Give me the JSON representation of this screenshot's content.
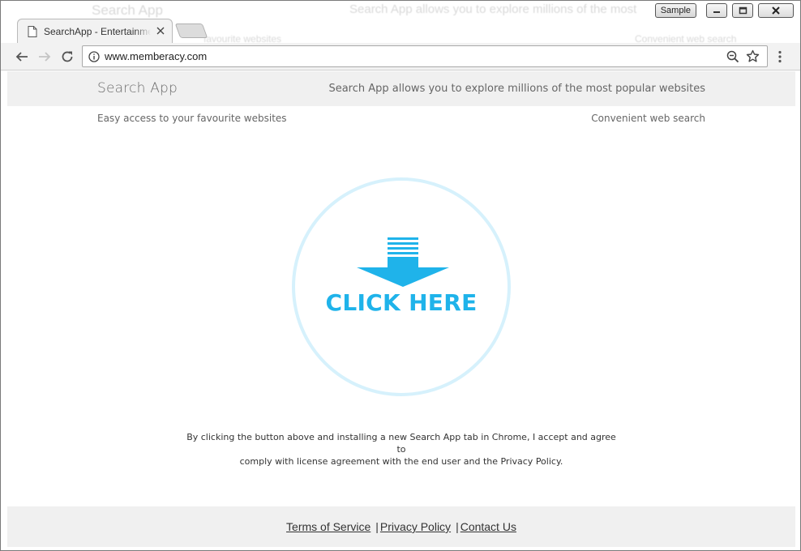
{
  "window": {
    "sample_label": "Sample",
    "ghost_brand": "Search App",
    "ghost_tagline": "Search App allows you to explore millions of the most",
    "ghost_feature_left": "favourite websites",
    "ghost_feature_right": "Convenient web search"
  },
  "tab": {
    "title": "SearchApp - Entertainment",
    "icon": "page-icon"
  },
  "toolbar": {
    "url": "www.memberacy.com"
  },
  "header": {
    "brand": "Search App",
    "tagline": "Search App allows you to explore millions of the most popular websites"
  },
  "features": {
    "left": "Easy access to your favourite websites",
    "right": "Convenient web search"
  },
  "cta": {
    "label": "CLICK HERE",
    "color": "#1fb3ea",
    "ring_color": "#d6f1fc"
  },
  "legal": {
    "line1": "By clicking the button above and installing a new Search App tab in Chrome, I accept and agree to",
    "line2": "comply with license agreement with the end user and the Privacy Policy."
  },
  "footer": {
    "links": [
      "Terms of Service",
      "Privacy Policy",
      "Contact Us"
    ],
    "separator": "|"
  }
}
